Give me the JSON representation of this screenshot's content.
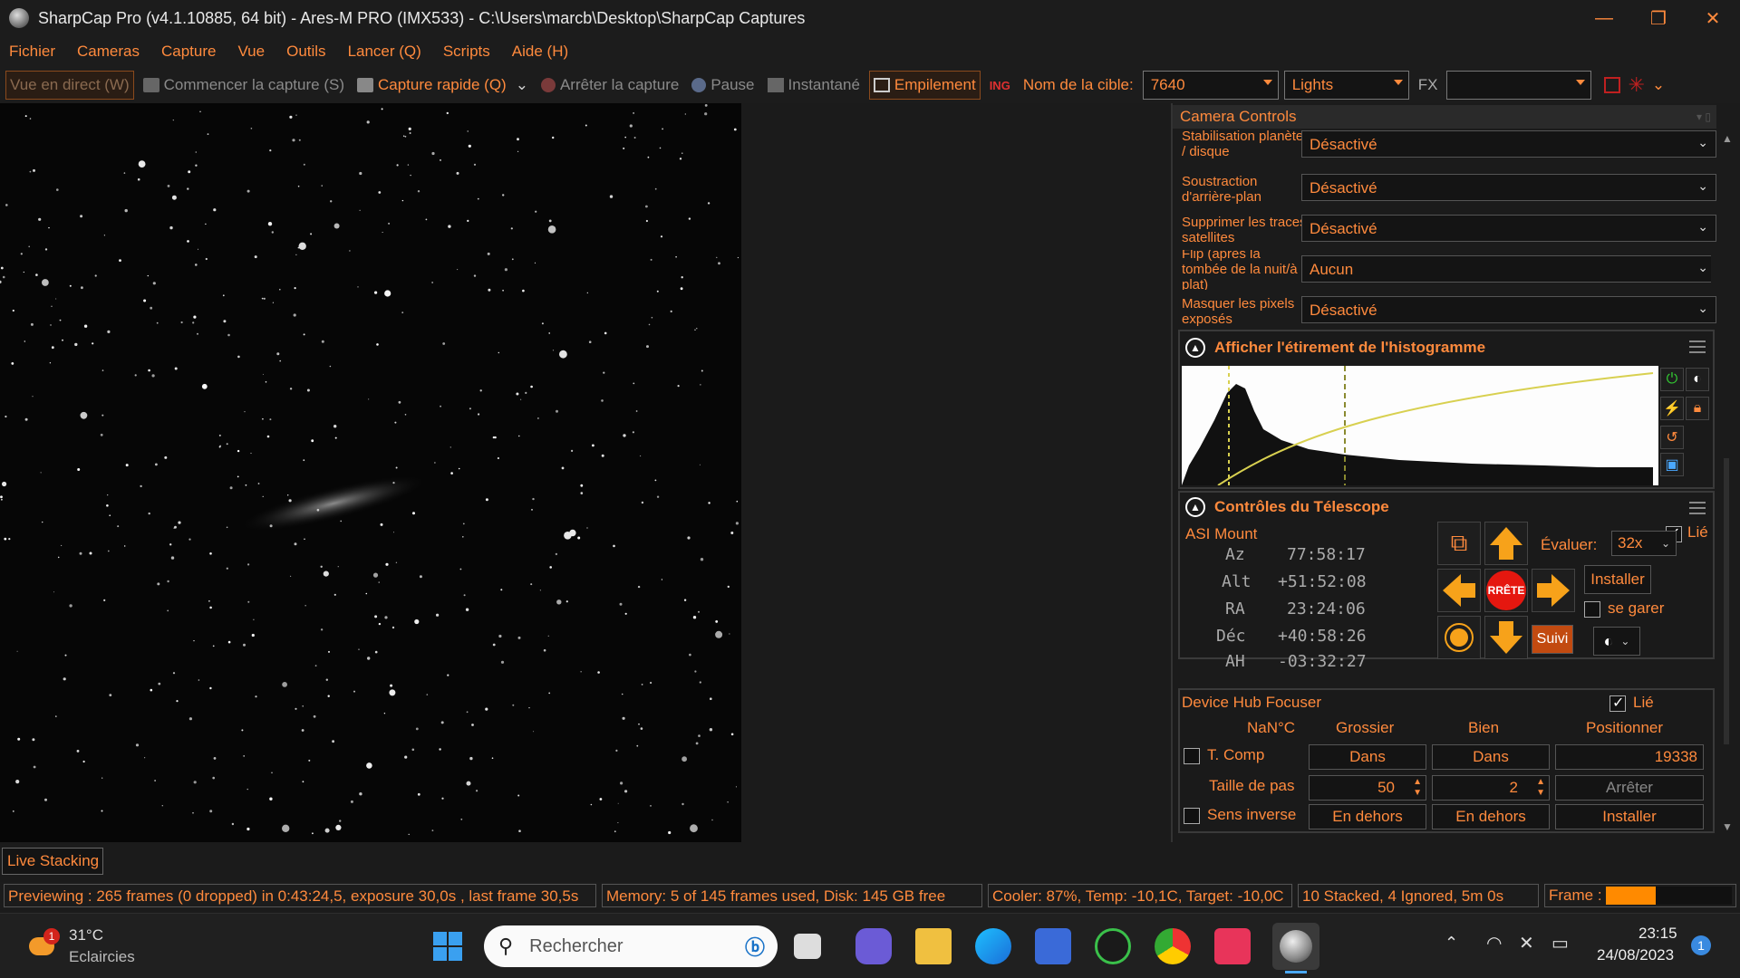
{
  "window": {
    "title": "SharpCap Pro (v4.1.10885, 64 bit) - Ares-M PRO (IMX533) - C:\\Users\\marcb\\Desktop\\SharpCap Captures"
  },
  "menu": [
    "Fichier",
    "Cameras",
    "Capture",
    "Vue",
    "Outils",
    "Lancer (Q)",
    "Scripts",
    "Aide (H)"
  ],
  "toolbar": {
    "live_view": "Vue en direct (W)",
    "start_capture": "Commencer la capture (S)",
    "quick_capture": "Capture rapide (Q)",
    "stop_capture": "Arrêter la capture",
    "pause": "Pause",
    "snapshot": "Instantané",
    "stacking": "Empilement",
    "target_label": "Nom de la cible:",
    "target_value": "7640",
    "frame_type": "Lights",
    "fx_label": "FX",
    "fx_value": ""
  },
  "camera_controls": {
    "header": "Camera Controls",
    "rows": [
      {
        "label": "Stabilisation planète / disque",
        "value": "Désactivé"
      },
      {
        "label": "Soustraction d'arrière-plan",
        "value": "Désactivé"
      },
      {
        "label": "Supprimer les traces satellites",
        "value": "Désactivé"
      },
      {
        "label": "Flip (après la tombée de la nuit/à plat)",
        "value": "Aucun"
      },
      {
        "label": "Masquer les pixels exposés",
        "value": "Désactivé"
      }
    ]
  },
  "histogram": {
    "title": "Afficher l'étirement de l'histogramme"
  },
  "telescope": {
    "title": "Contrôles du Télescope",
    "mount": "ASI Mount",
    "linked": "Lié",
    "coords": [
      {
        "k": "Az",
        "v": "77:58:17"
      },
      {
        "k": "Alt",
        "v": "+51:52:08"
      },
      {
        "k": "RA",
        "v": "23:24:06"
      },
      {
        "k": "Déc",
        "v": "+40:58:26"
      },
      {
        "k": "AH",
        "v": "-03:32:27"
      }
    ],
    "stop": "RRÊTE",
    "rate_label": "Évaluer:",
    "rate_value": "32x",
    "install": "Installer",
    "park": "se garer",
    "track": "Suivi"
  },
  "focuser": {
    "title": "Device Hub Focuser",
    "linked": "Lié",
    "temp": "NaN°C",
    "coarse": "Grossier",
    "fine": "Bien",
    "position_label": "Positionner",
    "tcomp": "T. Comp",
    "in1": "Dans",
    "in2": "Dans",
    "position": "19338",
    "step_label": "Taille de pas",
    "step_coarse": "50",
    "step_fine": "2",
    "stop": "Arrêter",
    "reverse": "Sens inverse",
    "out1": "En dehors",
    "out2": "En dehors",
    "install": "Installer"
  },
  "live_stacking": "Live Stacking",
  "status": {
    "preview": "Previewing : 265 frames (0 dropped) in 0:43:24,5, exposure 30,0s , last frame 30,5s",
    "memory": "Memory: 5 of 145 frames used, Disk: 145 GB free",
    "cooler": "Cooler: 87%, Temp: -10,1C, Target: -10,0C",
    "stacked": "10 Stacked, 4 Ignored, 5m 0s",
    "frame_label": "Frame :",
    "frame_progress": 0.4
  },
  "taskbar": {
    "weather_temp": "31°C",
    "weather_desc": "Eclaircies",
    "weather_badge": "1",
    "search": "Rechercher",
    "time": "23:15",
    "date": "24/08/2023",
    "notif": "1"
  },
  "colors": {
    "accent": "#ff8a3d",
    "stop": "#e5170f"
  }
}
